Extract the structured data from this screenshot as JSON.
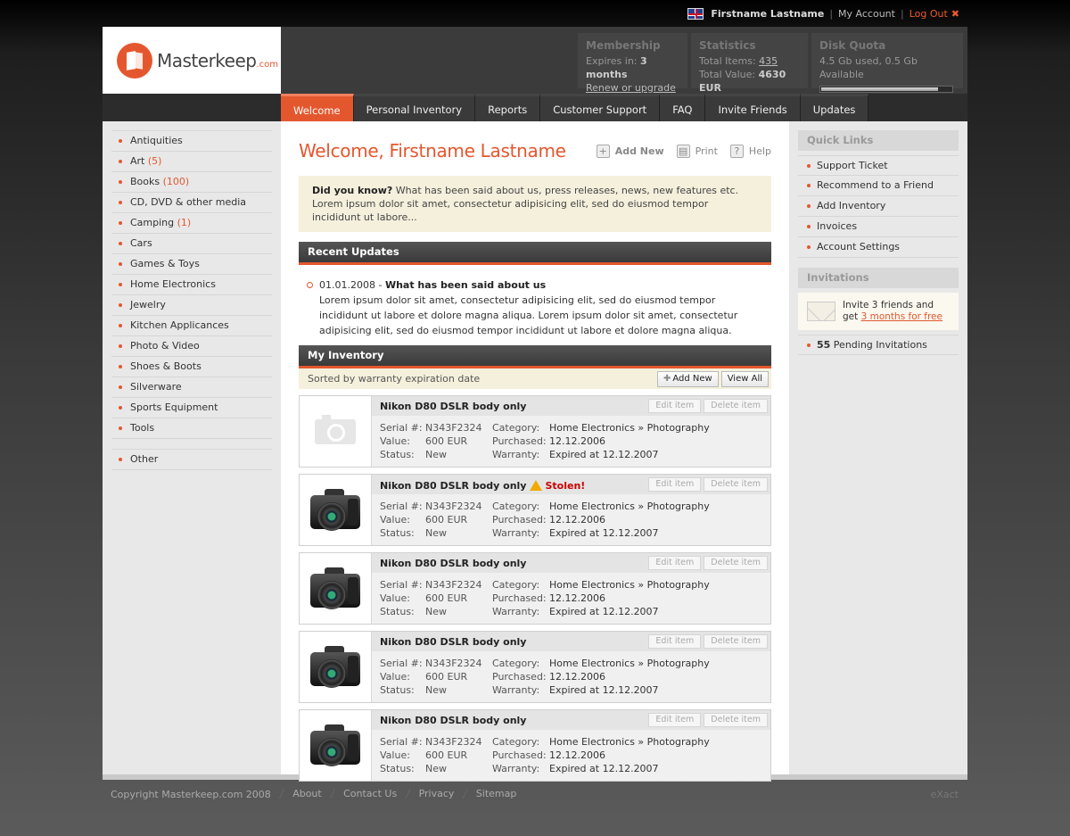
{
  "topbar": {
    "username": "Firstname Lastname",
    "my_account": "My Account",
    "logout": "Log Out"
  },
  "logo": {
    "name": "Masterkeep",
    "suffix": ".com"
  },
  "membership": {
    "title": "Membership",
    "expires_label": "Expires in:",
    "expires_value": "3 months",
    "renew": "Renew or upgrade"
  },
  "statistics": {
    "title": "Statistics",
    "items_label": "Total Items:",
    "items_value": "435",
    "value_label": "Total Value:",
    "value_value": "4630 EUR"
  },
  "disk": {
    "title": "Disk Quota",
    "text": "4.5 Gb used, 0.5 Gb Available",
    "used_fraction": 0.9
  },
  "nav": [
    {
      "label": "Welcome",
      "active": true
    },
    {
      "label": "Personal Inventory"
    },
    {
      "label": "Reports"
    },
    {
      "label": "Customer Support"
    },
    {
      "label": "FAQ"
    },
    {
      "label": "Invite Friends"
    },
    {
      "label": "Updates"
    }
  ],
  "categories": [
    {
      "label": "Antiquities",
      "count": ""
    },
    {
      "label": "Art",
      "count": "(5)"
    },
    {
      "label": "Books",
      "count": "(100)"
    },
    {
      "label": "CD, DVD & other media",
      "count": ""
    },
    {
      "label": "Camping",
      "count": "(1)"
    },
    {
      "label": "Cars",
      "count": ""
    },
    {
      "label": "Games & Toys",
      "count": ""
    },
    {
      "label": "Home Electronics",
      "count": ""
    },
    {
      "label": "Jewelry",
      "count": ""
    },
    {
      "label": "Kitchen Applicances",
      "count": ""
    },
    {
      "label": "Photo & Video",
      "count": ""
    },
    {
      "label": "Shoes & Boots",
      "count": ""
    },
    {
      "label": "Silverware",
      "count": ""
    },
    {
      "label": "Sports Equipment",
      "count": ""
    },
    {
      "label": "Tools",
      "count": ""
    }
  ],
  "category_other": "Other",
  "page": {
    "title": "Welcome, Firstname Lastname",
    "add_new": "Add New",
    "print": "Print",
    "help": "Help"
  },
  "dyk": {
    "label": "Did you know?",
    "text": " What has been said about us, press releases, news, new features etc. Lorem ipsum dolor sit amet, consectetur adipisicing elit, sed do eiusmod tempor incididunt ut labore..."
  },
  "recent": {
    "title": "Recent Updates",
    "date": "01.01.2008",
    "sep": " - ",
    "headline": "What has been said about us",
    "body": "Lorem ipsum dolor sit amet, consectetur adipisicing elit, sed do eiusmod tempor incididunt ut labore et dolore magna aliqua. Lorem ipsum dolor sit amet, consectetur adipisicing elit, sed do eiusmod tempor incididunt ut labore et dolore magna aliqua."
  },
  "inventory": {
    "title": "My Inventory",
    "sorted": "Sorted by warranty expiration date",
    "add_new": "Add New",
    "view_all": "View All",
    "edit": "Edit item",
    "delete": "Delete item",
    "labels": {
      "serial": "Serial #:",
      "value": "Value:",
      "status": "Status:",
      "category": "Category:",
      "purchased": "Purchased:",
      "warranty": "Warranty:"
    },
    "items": [
      {
        "name": "Nikon D80 DSLR body only",
        "stolen": "",
        "photo": false,
        "serial": "N343F2324",
        "value": "600 EUR",
        "status": "New",
        "cat1": "Home Electronics",
        "cat_sep": " » ",
        "cat2": "Photography",
        "purchased": "12.12.2006",
        "warranty": "Expired at 12.12.2007"
      },
      {
        "name": "Nikon D80 DSLR body only",
        "stolen": "Stolen!",
        "photo": true,
        "serial": "N343F2324",
        "value": "600 EUR",
        "status": "New",
        "cat1": "Home Electronics",
        "cat_sep": " » ",
        "cat2": "Photography",
        "purchased": "12.12.2006",
        "warranty": "Expired at 12.12.2007"
      },
      {
        "name": "Nikon D80 DSLR body only",
        "stolen": "",
        "photo": true,
        "serial": "N343F2324",
        "value": "600 EUR",
        "status": "New",
        "cat1": "Home Electronics",
        "cat_sep": " » ",
        "cat2": "Photography",
        "purchased": "12.12.2006",
        "warranty": "Expired at 12.12.2007"
      },
      {
        "name": "Nikon D80 DSLR body only",
        "stolen": "",
        "photo": true,
        "serial": "N343F2324",
        "value": "600 EUR",
        "status": "New",
        "cat1": "Home Electronics",
        "cat_sep": " » ",
        "cat2": "Photography",
        "purchased": "12.12.2006",
        "warranty": "Expired at 12.12.2007"
      },
      {
        "name": "Nikon D80 DSLR body only",
        "stolen": "",
        "photo": true,
        "serial": "N343F2324",
        "value": "600 EUR",
        "status": "New",
        "cat1": "Home Electronics",
        "cat_sep": " » ",
        "cat2": "Photography",
        "purchased": "12.12.2006",
        "warranty": "Expired at 12.12.2007"
      }
    ]
  },
  "quick_links": {
    "title": "Quick Links",
    "items": [
      "Support Ticket",
      "Recommend to a Friend",
      "Add Inventory",
      "Invoices",
      "Account Settings"
    ]
  },
  "invitations": {
    "title": "Invitations",
    "line1": "Invite 3 friends and",
    "line2_pre": "get ",
    "line2_link": "3 months for free",
    "pending_count": "55",
    "pending_label": " Pending Invitations"
  },
  "footer": {
    "copyright": "Copyright Masterkeep.com 2008",
    "links": [
      "About",
      "Contact Us",
      "Privacy",
      "Sitemap"
    ],
    "credit": "eXact"
  },
  "colors": {
    "accent": "#e4572e",
    "stolen": "#cc0000"
  }
}
